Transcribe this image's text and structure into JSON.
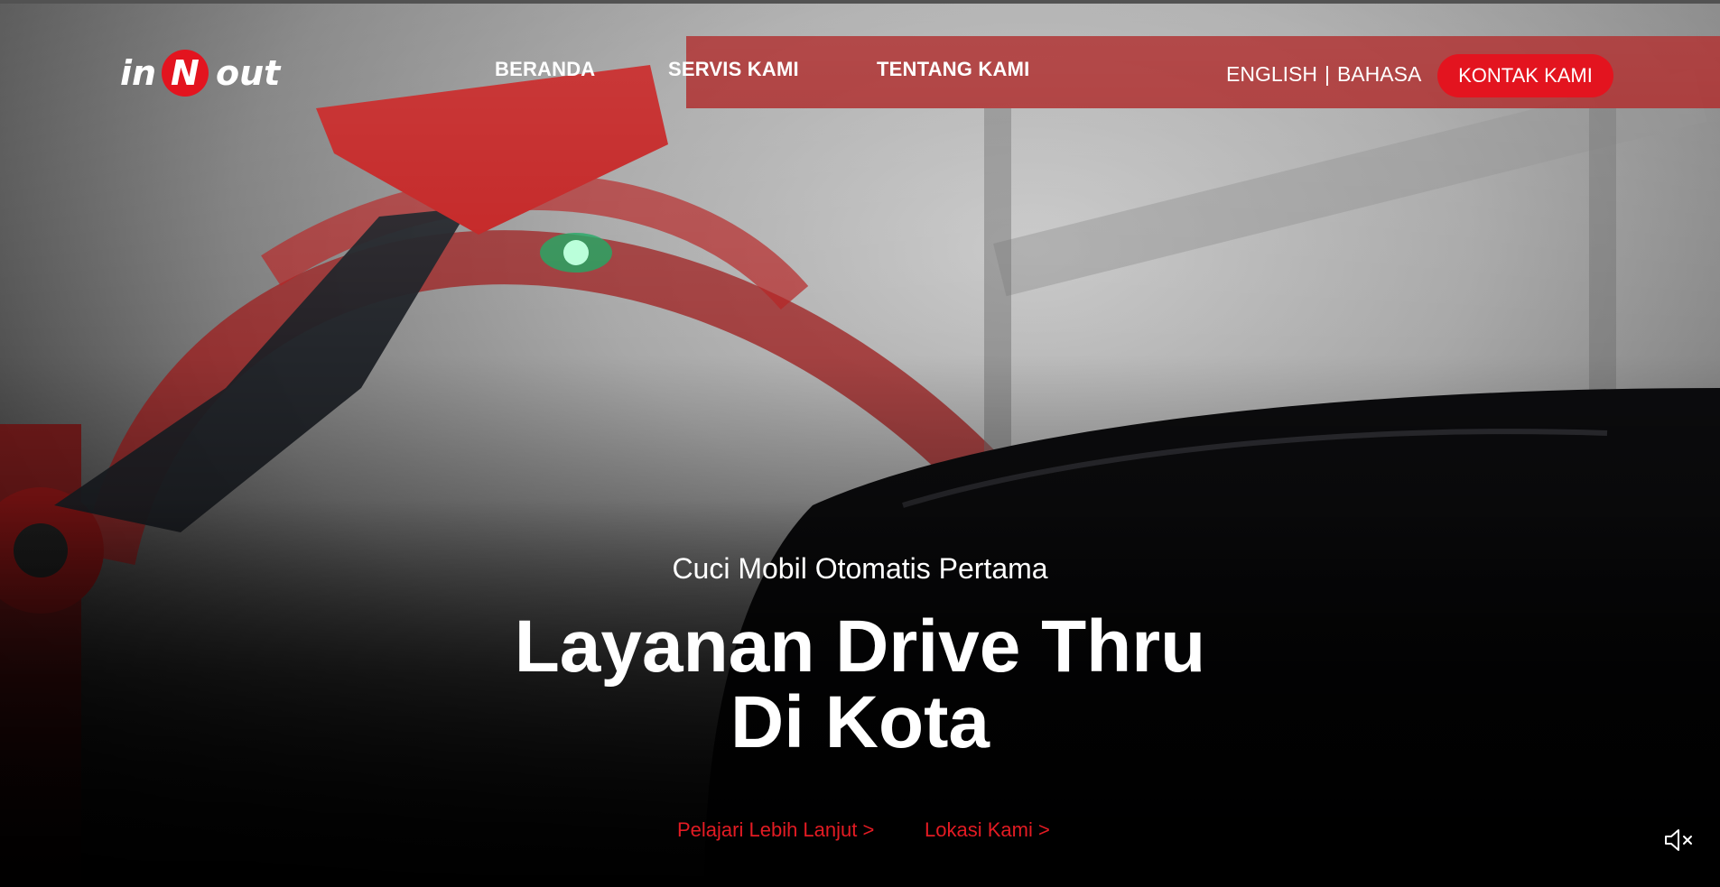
{
  "logo": {
    "alt": "in N out"
  },
  "nav": {
    "items": [
      {
        "label": "BERANDA"
      },
      {
        "label": "SERVIS KAMI"
      },
      {
        "label": "TENTANG KAMI"
      }
    ]
  },
  "language": {
    "english": "ENGLISH",
    "separator": "|",
    "bahasa": "BAHASA"
  },
  "contact_button": {
    "label": "KONTAK KAMI"
  },
  "hero": {
    "subtitle": "Cuci Mobil Otomatis Pertama",
    "title_line1": "Layanan Drive Thru",
    "title_line2": "Di Kota"
  },
  "links": {
    "learn_more": "Pelajari Lebih Lanjut >",
    "locations": "Lokasi Kami >"
  },
  "colors": {
    "accent": "#e3141f",
    "text": "#ffffff"
  },
  "icons": {
    "mute": "volume-mute-icon"
  }
}
